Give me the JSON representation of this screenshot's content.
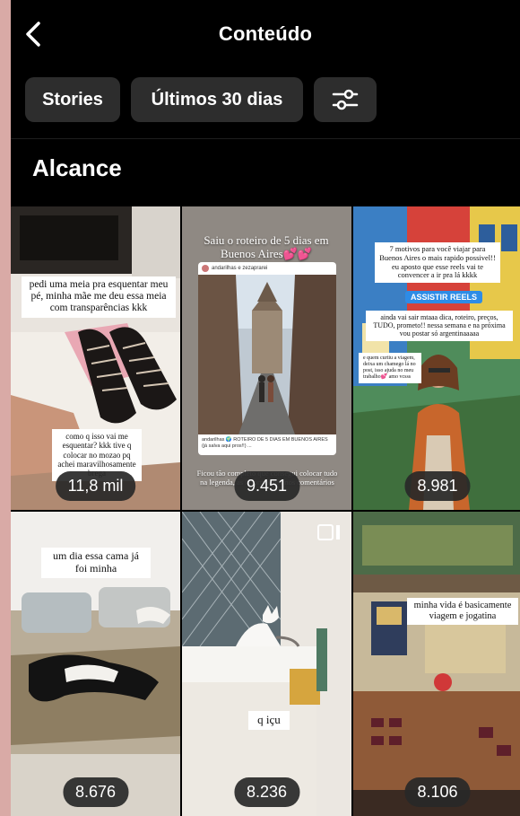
{
  "header": {
    "title": "Conteúdo",
    "back_icon": "chevron-left-icon"
  },
  "filters": {
    "type_label": "Stories",
    "period_label": "Últimos 30 dias",
    "settings_icon": "sliders-icon"
  },
  "section": {
    "title": "Alcance"
  },
  "colors": {
    "background": "#000000",
    "chip": "#2d2d2d",
    "metric_pill": "#282828",
    "frame": "#d9aaa6"
  },
  "tiles": [
    {
      "metric": "11,8 mil",
      "caption_top": "pedi uma meia pra esquentar meu pé, minha mãe me deu essa meia com transparências kkk",
      "caption_bottom": "como q isso vai me esquentar? kkk tive q colocar no mozao pq achei maravilhosamente brega"
    },
    {
      "metric": "9.451",
      "caption_top": "Saiu o roteiro de 5 dias em Buenos Aires💕💕",
      "card_user": "andarilhas e zezaprarei",
      "card_text": "andarilhas 🌍 ROTEIRO DE 5 DIAS EM BUENOS AIRES (já salva aqui pros!!) ...",
      "caption_bottom": "Ficou tão completo que consegui colocar tudo na legenda, as informações nos comentários"
    },
    {
      "metric": "8.981",
      "caption_top": "7 motivos para você viajar para Buenos Aires o mais rapido possivel!! eu aposto que esse reels vai te convencer a ir pra lá kkkk",
      "button": "ASSISTIR REELS",
      "caption_mid": "ainda vai sair mtaaa dica, roteiro, preços, TUDO, prometo!! nessa semana e na próxima vou postar só argentinaaaaa",
      "caption_side": "e quem curtiu a viagem, deixa um chamego lá no post, isso ajuda no meu trabalho💕 amo vcsss"
    },
    {
      "metric": "8.676",
      "caption_top": "um dia essa cama já foi minha"
    },
    {
      "metric": "8.236",
      "caption_mid": "q içu"
    },
    {
      "metric": "8.106",
      "caption_top": "minha vida é basicamente viagem e jogatina"
    }
  ]
}
